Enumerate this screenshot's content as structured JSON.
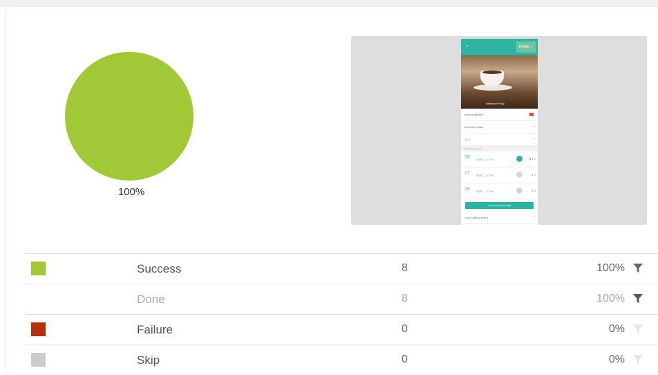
{
  "pie": {
    "label": "100%",
    "success_fraction": 1.0,
    "color": "#a1c837"
  },
  "screenshot_preview": {
    "header_color": "#2fb4a3",
    "back_glyph": "←",
    "done_label": "DONE ✓",
    "photo_caption": "Alabama Pinup",
    "rows": [
      {
        "text": "Kona podplatit?",
        "icon": "flag-icon"
      },
      {
        "text": "Brunnen rostas",
        "icon": "location-icon"
      },
      {
        "text": "1 / 4",
        "icon": "people-icon"
      }
    ],
    "section": "SEPTEMBER 2017",
    "dates": [
      {
        "day": "15",
        "time": "10:00 — 11:00",
        "active": true,
        "mini": "● 1 >"
      },
      {
        "day": "17",
        "time": "18:00 — 21:00",
        "active": false,
        "mini": "1 >"
      },
      {
        "day": "26",
        "time": "18:00 — 21:00",
        "active": false,
        "mini": "1 >"
      }
    ],
    "add_button": "⊕ ADD DATE AND TIME",
    "footer_row": "I can't attend event"
  },
  "table": {
    "rows": [
      {
        "label": "Success",
        "count": "8",
        "percent": "100%",
        "color": "#a1c837",
        "muted": false,
        "filter_color": "#666666",
        "has_swatch": true
      },
      {
        "label": "Done",
        "count": "8",
        "percent": "100%",
        "color": "",
        "muted": true,
        "filter_color": "#555555",
        "has_swatch": false
      },
      {
        "label": "Failure",
        "count": "0",
        "percent": "0%",
        "color": "#b5300b",
        "muted": false,
        "filter_color": "#e4e4e4",
        "has_swatch": true
      },
      {
        "label": "Skip",
        "count": "0",
        "percent": "0%",
        "color": "#cccccc",
        "muted": false,
        "filter_color": "#e4e4e4",
        "has_swatch": true
      }
    ],
    "filter_icon": "filter-icon"
  }
}
